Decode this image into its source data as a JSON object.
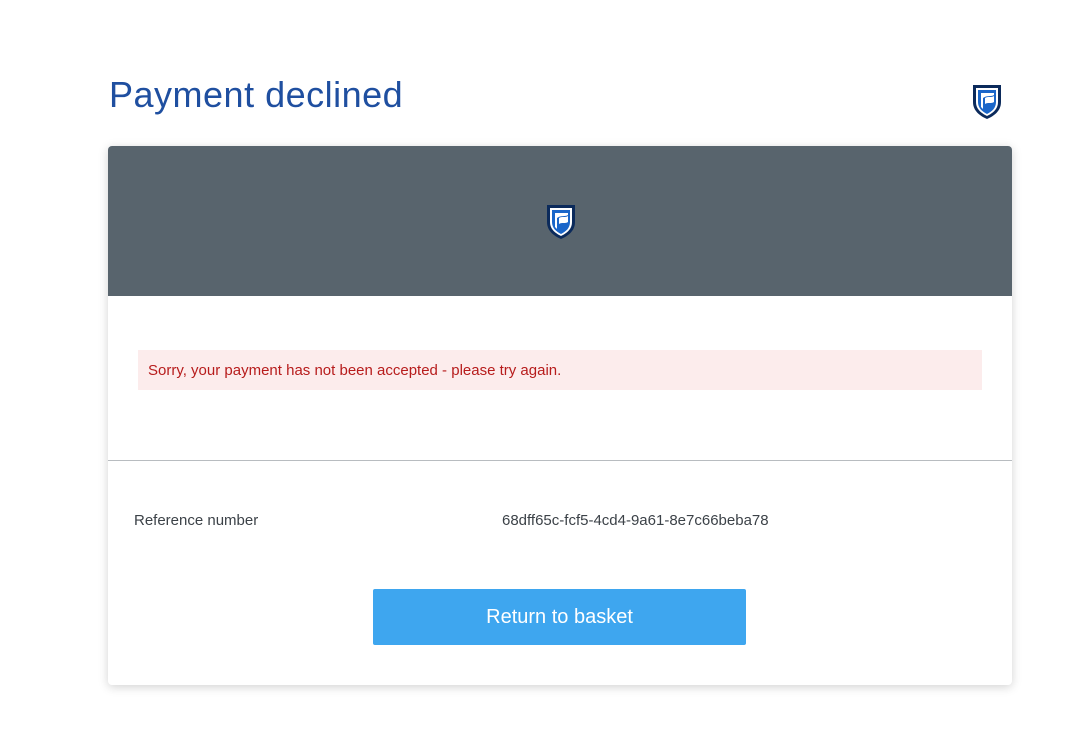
{
  "page": {
    "title": "Payment declined"
  },
  "icons": {
    "corner_logo": "bank-shield-logo-icon",
    "header_logo": "bank-shield-logo-icon"
  },
  "colors": {
    "title": "#1f4fa0",
    "header_background": "#58646d",
    "error_background": "#fcecec",
    "error_text": "#b71c1c",
    "button_background": "#3ea6ef",
    "button_text": "#ffffff",
    "logo_blue": "#1a66c9",
    "logo_navy": "#0b2a5b"
  },
  "message": {
    "error": "Sorry, your payment has not been accepted - please try again."
  },
  "reference": {
    "label": "Reference number",
    "value": "68dff65c-fcf5-4cd4-9a61-8e7c66beba78"
  },
  "actions": {
    "return_label": "Return to basket"
  }
}
